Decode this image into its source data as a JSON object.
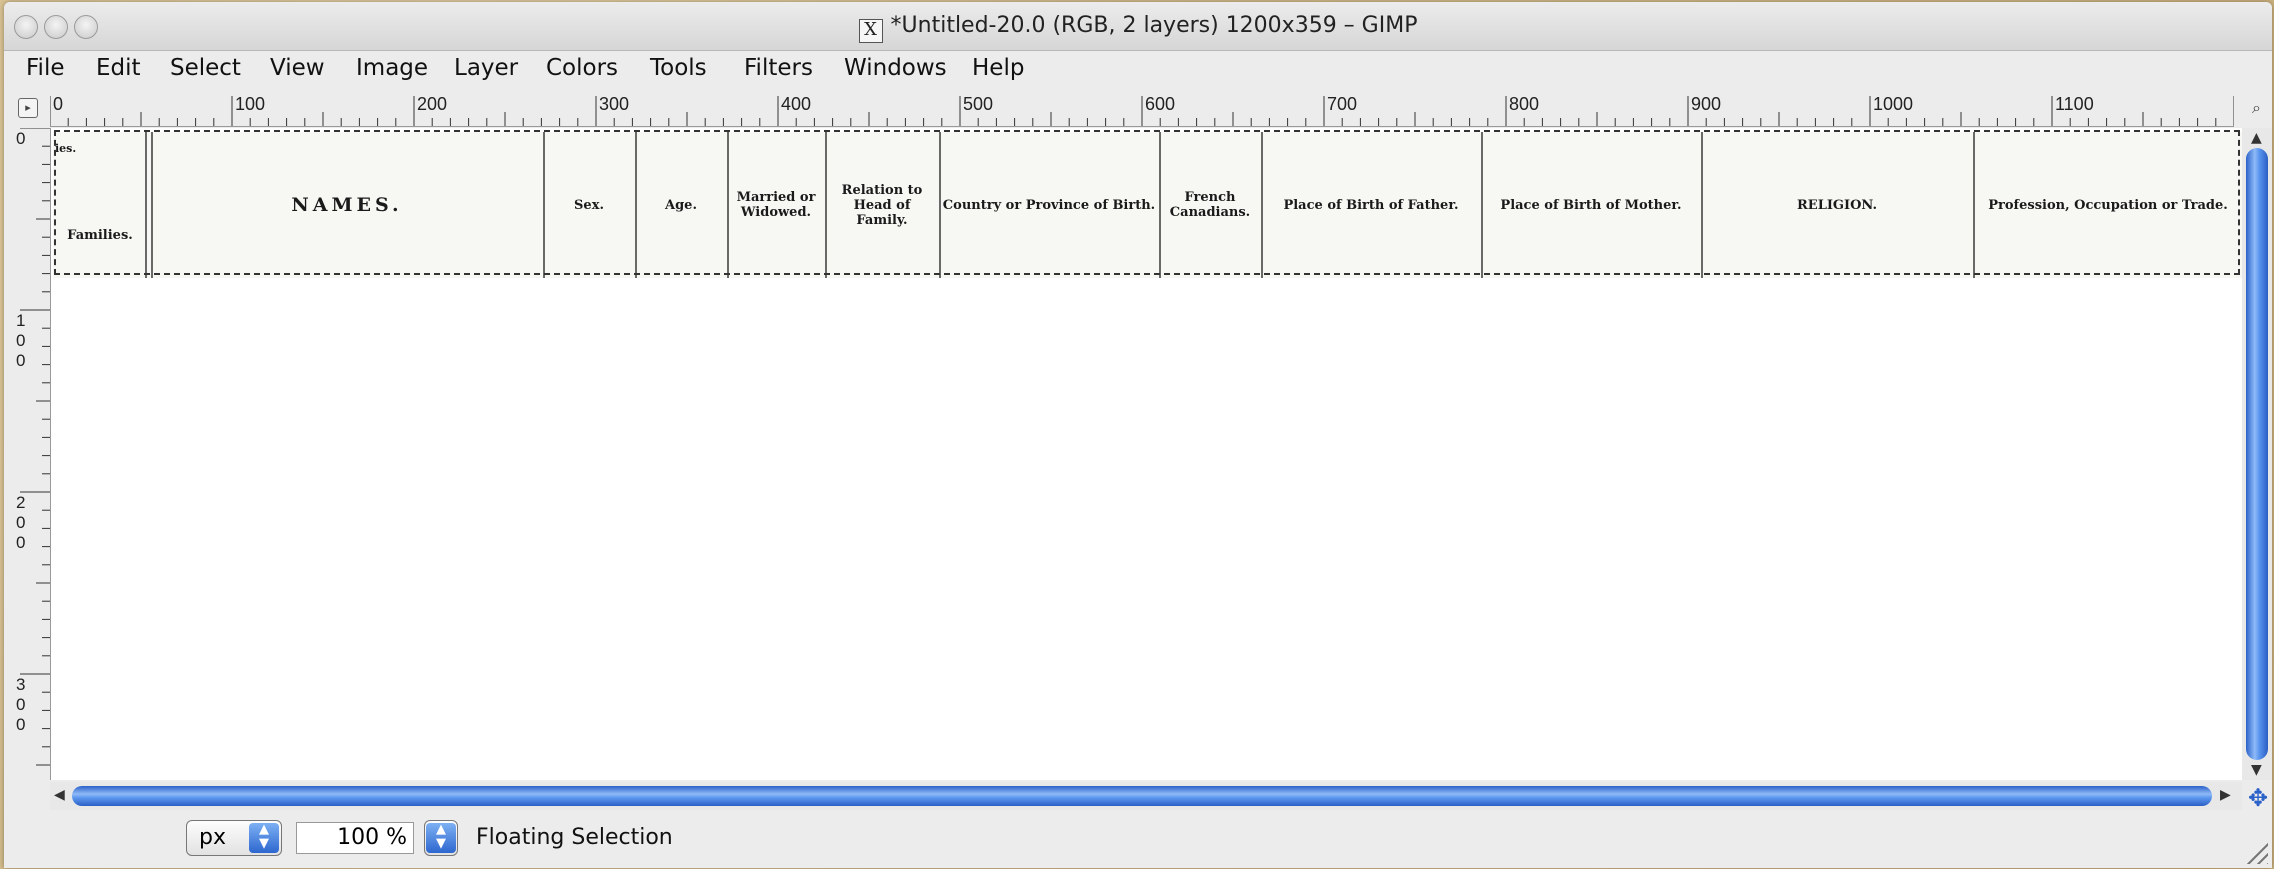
{
  "window": {
    "title": "*Untitled-20.0 (RGB, 2 layers) 1200x359 – GIMP",
    "title_icon": "x11-icon"
  },
  "menubar": {
    "items": [
      {
        "label": "File"
      },
      {
        "label": "Edit"
      },
      {
        "label": "Select"
      },
      {
        "label": "View"
      },
      {
        "label": "Image"
      },
      {
        "label": "Layer"
      },
      {
        "label": "Colors"
      },
      {
        "label": "Tools"
      },
      {
        "label": "Filters"
      },
      {
        "label": "Windows"
      },
      {
        "label": "Help"
      }
    ]
  },
  "ruler_h": {
    "labels": [
      "0",
      "100",
      "200",
      "300",
      "400",
      "500",
      "600",
      "700",
      "800",
      "900",
      "1000",
      "1100"
    ]
  },
  "ruler_v": {
    "labels": [
      "0",
      "100",
      "200",
      "300"
    ]
  },
  "image_header": {
    "fragment_top": "ies.",
    "columns": [
      "Families.",
      "NAMES.",
      "Sex.",
      "Age.",
      "Married or Widowed.",
      "Relation to Head of Family.",
      "Country or Province of Birth.",
      "French Canadians.",
      "Place of Birth of Father.",
      "Place of Birth of Mother.",
      "RELIGION.",
      "Profession, Occupation or Trade."
    ]
  },
  "statusbar": {
    "unit": "px",
    "zoom": "100 %",
    "message": "Floating Selection"
  },
  "colors": {
    "scroll_accent": "#2b62c9",
    "canvas_bg": "#ffffff",
    "window_bg": "#ececec"
  }
}
